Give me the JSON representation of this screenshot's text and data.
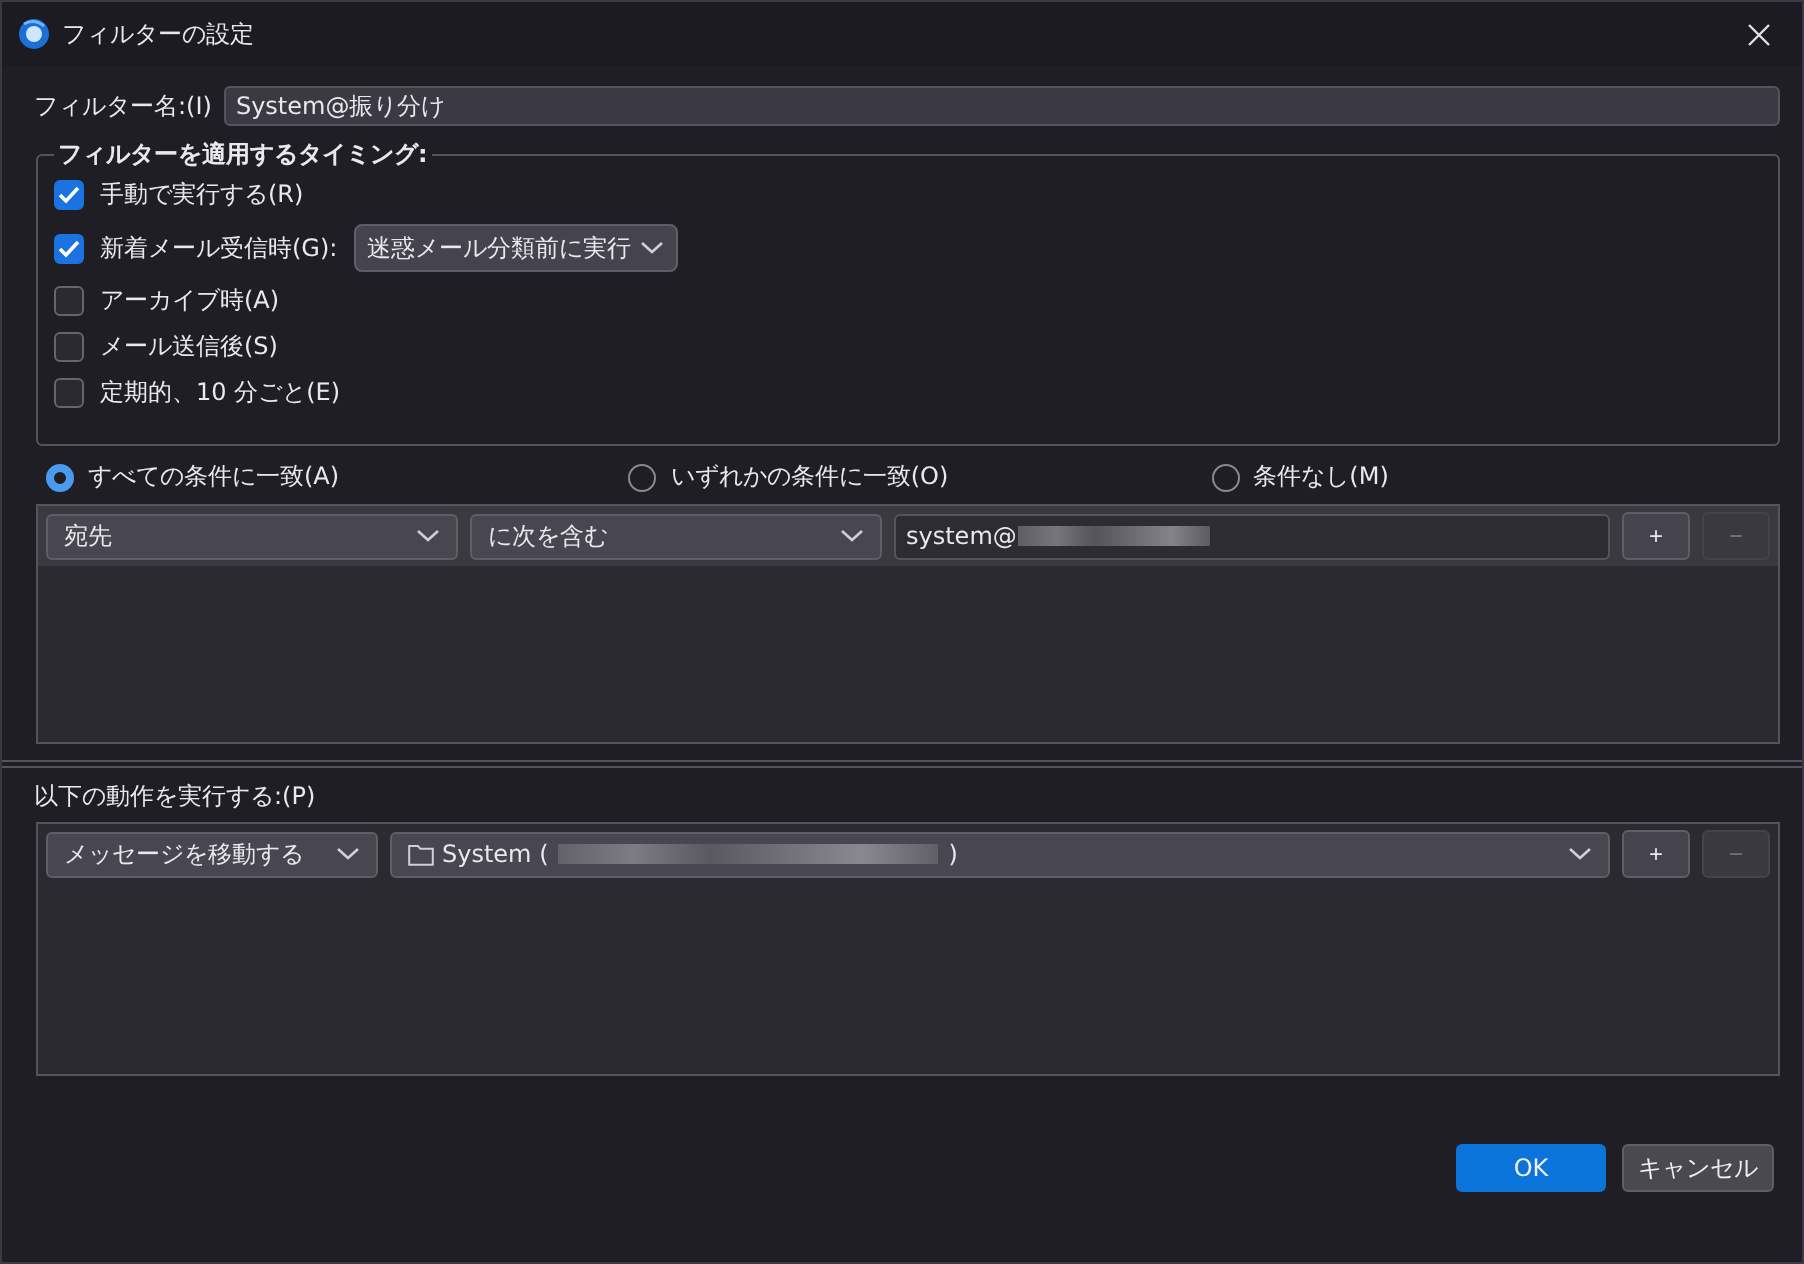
{
  "window": {
    "title": "フィルターの設定"
  },
  "filter_name": {
    "label": "フィルター名:(I)",
    "value": "System@振り分け"
  },
  "timing": {
    "legend": "フィルターを適用するタイミング:",
    "options": [
      {
        "label": "手動で実行する(R)",
        "checked": true
      },
      {
        "label": "新着メール受信時(G):",
        "checked": true,
        "dropdown": "迷惑メール分類前に実行"
      },
      {
        "label": "アーカイブ時(A)",
        "checked": false
      },
      {
        "label": "メール送信後(S)",
        "checked": false
      },
      {
        "label": "定期的、10 分ごと(E)",
        "checked": false
      }
    ]
  },
  "match": [
    {
      "label": "すべての条件に一致(A)",
      "selected": true
    },
    {
      "label": "いずれかの条件に一致(O)",
      "selected": false
    },
    {
      "label": "条件なし(M)",
      "selected": false
    }
  ],
  "conditions": [
    {
      "field": "宛先",
      "operator": "に次を含む",
      "value": "system@",
      "redacted": true
    }
  ],
  "condition_buttons": [
    {
      "label": "+",
      "disabled": false
    },
    {
      "label": "−",
      "disabled": true
    }
  ],
  "actions_label": "以下の動作を実行する:(P)",
  "actions": [
    {
      "action": "メッセージを移動する",
      "target": "System (",
      "target_end": ")",
      "redacted": true
    }
  ],
  "action_buttons": [
    {
      "label": "+",
      "disabled": false
    },
    {
      "label": "−",
      "disabled": true
    }
  ],
  "buttons": [
    {
      "label": "OK",
      "kind": "primary"
    },
    {
      "label": "キャンセル",
      "kind": "secondary"
    }
  ]
}
